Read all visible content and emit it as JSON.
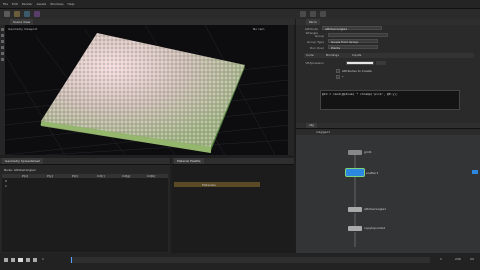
{
  "app": {
    "title": "Houdini"
  },
  "menubar": {
    "items": [
      "File",
      "Edit",
      "Render",
      "Assets",
      "Windows",
      "Help"
    ]
  },
  "viewport": {
    "tab_label": "Scene View",
    "header_label": "Geometry Viewport",
    "camera_label": "No cam"
  },
  "params": {
    "tab_label": "Parm",
    "node_type": "Attribute Wrangle",
    "node_name": "attribwrangle1",
    "group_label": "Group",
    "group_type_label": "Group Type",
    "group_type_value": "Guess from Group",
    "run_over_label": "Run Over",
    "run_over_value": "Points",
    "tab_code": "Code",
    "tab_bindings": "Bindings",
    "tab_input": "Inputs",
    "vexpr_label": "VEXpression",
    "vex_code": "@Cd = rand(@ptnum) * chramp('pick', @P.y);",
    "check_label": "Attributes to Create",
    "check_value": "*"
  },
  "network": {
    "tab_label": "obj",
    "path": "/obj/geo1",
    "nodes": [
      {
        "name": "grid1",
        "color": "#888888",
        "selected": false
      },
      {
        "name": "scatter1",
        "color": "#1f6fd1",
        "selected": true
      },
      {
        "name": "attribwrangle1",
        "color": "#aaaaaa",
        "selected": false
      },
      {
        "name": "copytopoints1",
        "color": "#aaaaaa",
        "selected": false
      }
    ]
  },
  "spreadsheet": {
    "tab_label": "Geometry Spreadsheet",
    "node_label": "Node: attribwrangle1",
    "columns": [
      "P[x]",
      "P[y]",
      "P[z]",
      "Cd[r]",
      "Cd[g]",
      "Cd[b]"
    ],
    "rows": [
      "0",
      "1"
    ]
  },
  "panel2": {
    "tab_label": "Material Palette",
    "item": "Materials"
  },
  "timeline": {
    "frame": "1",
    "start": "1",
    "end": "240",
    "fps": "24"
  }
}
